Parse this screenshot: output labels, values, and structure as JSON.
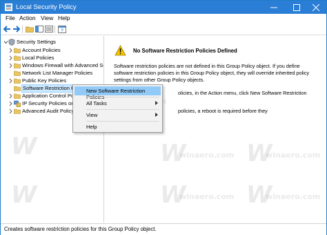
{
  "window": {
    "title": "Local Security Policy"
  },
  "menubar": {
    "items": [
      "File",
      "Action",
      "View",
      "Help"
    ]
  },
  "toolbar": {
    "buttons": [
      "back-icon",
      "forward-icon",
      "up-folder-icon",
      "show-hide-tree-icon",
      "export-list-icon",
      "help-icon"
    ]
  },
  "tree": {
    "root": "Security Settings",
    "items": [
      {
        "label": "Account Policies",
        "icon": "folder-icon",
        "expandable": true
      },
      {
        "label": "Local Policies",
        "icon": "folder-icon",
        "expandable": true
      },
      {
        "label": "Windows Firewall with Advanced Sec",
        "icon": "folder-icon",
        "expandable": true
      },
      {
        "label": "Network List Manager Policies",
        "icon": "folder-icon",
        "expandable": false
      },
      {
        "label": "Public Key Policies",
        "icon": "folder-icon",
        "expandable": true
      },
      {
        "label": "Software Restriction Poli",
        "icon": "folder-icon",
        "expandable": false,
        "selected": true
      },
      {
        "label": "Application Control Po",
        "icon": "folder-icon",
        "expandable": true
      },
      {
        "label": "IP Security Policies on",
        "icon": "ip-security-icon",
        "expandable": true
      },
      {
        "label": "Advanced Audit Policy",
        "icon": "folder-icon",
        "expandable": true
      }
    ]
  },
  "detail": {
    "heading": "No Software Restriction Policies Defined",
    "paragraph1": [
      "Software restriction policies are not defined in this Group Policy object. If you define",
      "software restriction policies in this Group Policy object, they will override inherited policy",
      "settings from other Group Policy objects."
    ],
    "paragraph2": "olicies, in the Action menu, click New Software Restriction",
    "paragraph3": "policies, a reboot is required before they"
  },
  "context_menu": {
    "items": [
      {
        "label": "New Software Restriction Policies",
        "submenu": false,
        "highlighted": true
      },
      {
        "label": "All Tasks",
        "submenu": true
      },
      {
        "label": "View",
        "submenu": true
      },
      {
        "label": "Help",
        "submenu": false
      }
    ]
  },
  "statusbar": {
    "text": "Creates software restriction policies for this Group Policy object."
  },
  "watermark": {
    "letter": "W",
    "text": "winaero.com"
  },
  "colors": {
    "titlebar": "#2b7ed6",
    "selection": "#cce8ff",
    "menu_highlight": "#91c9f7",
    "warning": "#f6c500"
  }
}
